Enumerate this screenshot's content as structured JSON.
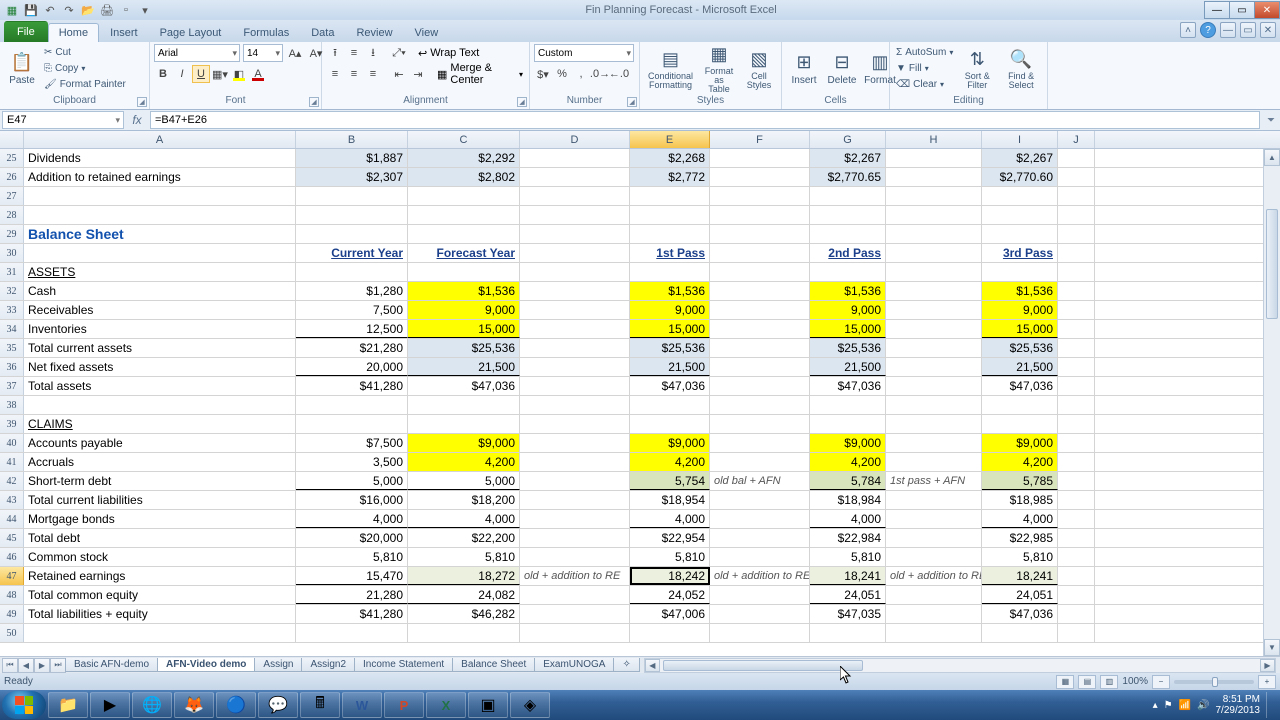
{
  "title": "Fin Planning Forecast - Microsoft Excel",
  "tabs": {
    "file": "File",
    "home": "Home",
    "insert": "Insert",
    "page": "Page Layout",
    "formulas": "Formulas",
    "data": "Data",
    "review": "Review",
    "view": "View"
  },
  "ribbon": {
    "clipboard": {
      "paste": "Paste",
      "cut": "Cut",
      "copy": "Copy",
      "fp": "Format Painter",
      "label": "Clipboard"
    },
    "font": {
      "name": "Arial",
      "size": "14",
      "label": "Font"
    },
    "align": {
      "wrap": "Wrap Text",
      "merge": "Merge & Center",
      "label": "Alignment"
    },
    "number": {
      "fmt": "Custom",
      "label": "Number"
    },
    "styles": {
      "cf": "Conditional Formatting",
      "fat": "Format as Table",
      "cs": "Cell Styles",
      "label": "Styles"
    },
    "cells": {
      "ins": "Insert",
      "del": "Delete",
      "fmt": "Format",
      "label": "Cells"
    },
    "editing": {
      "sum": "AutoSum",
      "fill": "Fill",
      "clear": "Clear",
      "sort": "Sort & Filter",
      "find": "Find & Select",
      "label": "Editing"
    }
  },
  "namebox": "E47",
  "formula": "=B47+E26",
  "columns": [
    "A",
    "B",
    "C",
    "D",
    "E",
    "F",
    "G",
    "H",
    "I",
    "J"
  ],
  "rowlabels": [
    "25",
    "26",
    "27",
    "28",
    "29",
    "30",
    "31",
    "32",
    "33",
    "34",
    "35",
    "36",
    "37",
    "38",
    "39",
    "40",
    "41",
    "42",
    "43",
    "44",
    "45",
    "46",
    "47",
    "48",
    "49",
    "50"
  ],
  "headers": {
    "cur": "Current Year",
    "fore": "Forecast Year",
    "p1": "1st Pass",
    "p2": "2nd Pass",
    "p3": "3rd Pass"
  },
  "labels": {
    "dividends": "Dividends",
    "addre": "Addition to retained earnings",
    "bs": "Balance Sheet",
    "assets": "ASSETS",
    "cash": "Cash",
    "recv": "Receivables",
    "inv": "Inventories",
    "tca": "    Total current assets",
    "nfa": "Net fixed assets",
    "ta": "Total assets",
    "claims": "CLAIMS",
    "ap": "Accounts payable",
    "acc": "Accruals",
    "std": "Short-term debt",
    "tcl": "    Total current liabilities",
    "mort": "Mortgage bonds",
    "td": "    Total debt",
    "cs": "Common stock",
    "re": "Retained earnings",
    "tce": "    Total common equity",
    "tle": "Total liabilities + equity",
    "note_re": "old + addition to RE",
    "note_std1": "old bal + AFN",
    "note_std2": "1st pass + AFN"
  },
  "v": {
    "div": {
      "b": "$1,887",
      "c": "$2,292",
      "e": "$2,268",
      "g": "$2,267",
      "i": "$2,267"
    },
    "addre": {
      "b": "$2,307",
      "c": "$2,802",
      "e": "$2,772",
      "g": "$2,770.65",
      "i": "$2,770.60"
    },
    "cash": {
      "b": "$1,280",
      "c": "$1,536",
      "e": "$1,536",
      "g": "$1,536",
      "i": "$1,536"
    },
    "recv": {
      "b": "7,500",
      "c": "9,000",
      "e": "9,000",
      "g": "9,000",
      "i": "9,000"
    },
    "inv": {
      "b": "12,500",
      "c": "15,000",
      "e": "15,000",
      "g": "15,000",
      "i": "15,000"
    },
    "tca": {
      "b": "$21,280",
      "c": "$25,536",
      "e": "$25,536",
      "g": "$25,536",
      "i": "$25,536"
    },
    "nfa": {
      "b": "20,000",
      "c": "21,500",
      "e": "21,500",
      "g": "21,500",
      "i": "21,500"
    },
    "ta": {
      "b": "$41,280",
      "c": "$47,036",
      "e": "$47,036",
      "g": "$47,036",
      "i": "$47,036"
    },
    "ap": {
      "b": "$7,500",
      "c": "$9,000",
      "e": "$9,000",
      "g": "$9,000",
      "i": "$9,000"
    },
    "acc": {
      "b": "3,500",
      "c": "4,200",
      "e": "4,200",
      "g": "4,200",
      "i": "4,200"
    },
    "std": {
      "b": "5,000",
      "c": "5,000",
      "e": "5,754",
      "g": "5,784",
      "i": "5,785"
    },
    "tcl": {
      "b": "$16,000",
      "c": "$18,200",
      "e": "$18,954",
      "g": "$18,984",
      "i": "$18,985"
    },
    "mort": {
      "b": "4,000",
      "c": "4,000",
      "e": "4,000",
      "g": "4,000",
      "i": "4,000"
    },
    "td": {
      "b": "$20,000",
      "c": "$22,200",
      "e": "$22,954",
      "g": "$22,984",
      "i": "$22,985"
    },
    "cs": {
      "b": "5,810",
      "c": "5,810",
      "e": "5,810",
      "g": "5,810",
      "i": "5,810"
    },
    "re": {
      "b": "15,470",
      "c": "18,272",
      "e": "18,242",
      "g": "18,241",
      "i": "18,241"
    },
    "tce": {
      "b": "21,280",
      "c": "24,082",
      "e": "24,052",
      "g": "24,051",
      "i": "24,051"
    },
    "tle": {
      "b": "$41,280",
      "c": "$46,282",
      "e": "$47,006",
      "g": "$47,035",
      "i": "$47,036"
    }
  },
  "sheets": [
    "Basic AFN-demo",
    "AFN-Video demo",
    "Assign",
    "Assign2",
    "Income Statement",
    "Balance Sheet",
    "ExamUNOGA"
  ],
  "active_sheet": 1,
  "status": "Ready",
  "zoom": "100%",
  "clock": {
    "time": "8:51 PM",
    "date": "7/29/2013"
  }
}
